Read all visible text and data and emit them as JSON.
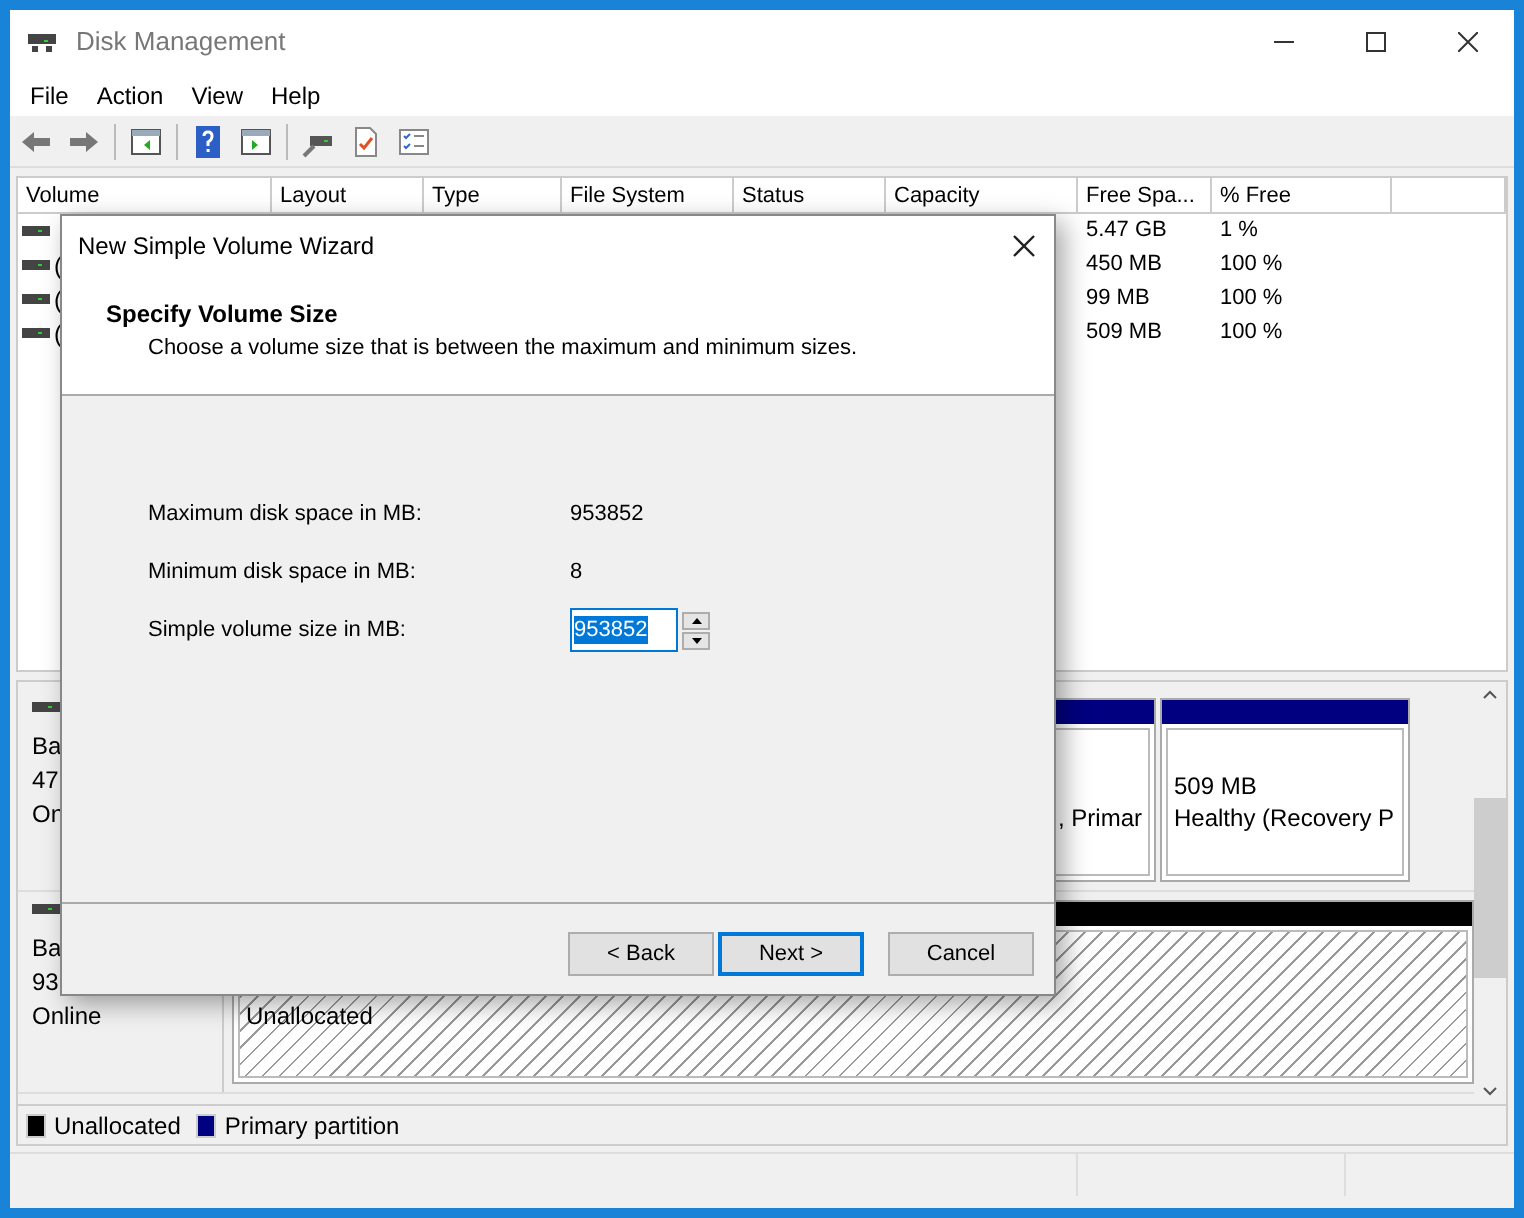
{
  "window": {
    "title": "Disk Management"
  },
  "menu": [
    {
      "label": "File"
    },
    {
      "label": "Action"
    },
    {
      "label": "View"
    },
    {
      "label": "Help"
    }
  ],
  "volume_list": {
    "columns": [
      "Volume",
      "Layout",
      "Type",
      "File System",
      "Status",
      "Capacity",
      "Free Spa...",
      "% Free"
    ],
    "rows": [
      {
        "free_space": "5.47 GB",
        "percent_free": "1 %"
      },
      {
        "volume": "(",
        "free_space": "450 MB",
        "percent_free": "100 %"
      },
      {
        "volume": "(",
        "free_space": "99 MB",
        "percent_free": "100 %"
      },
      {
        "volume": "(",
        "free_space": "509 MB",
        "percent_free": "100 %"
      }
    ]
  },
  "disks": [
    {
      "info": [
        "Ba",
        "47",
        "On"
      ],
      "partitions": [
        {
          "kind": "primary",
          "lines": [
            ", Primar"
          ]
        },
        {
          "kind": "primary",
          "lines": [
            "509 MB",
            "Healthy (Recovery P"
          ]
        }
      ]
    },
    {
      "info": [
        "Ba",
        "93",
        "Online"
      ],
      "partitions": [
        {
          "kind": "unallocated",
          "lines": [
            "Unallocated"
          ]
        }
      ]
    }
  ],
  "legend": [
    {
      "label": "Unallocated",
      "color": "#000000"
    },
    {
      "label": "Primary partition",
      "color": "#000080"
    }
  ],
  "dialog": {
    "title": "New Simple Volume Wizard",
    "heading": "Specify Volume Size",
    "subtitle": "Choose a volume size that is between the maximum and minimum sizes.",
    "fields": [
      {
        "kind": "text",
        "label": "Maximum disk space in MB:",
        "value": "953852"
      },
      {
        "kind": "text",
        "label": "Minimum disk space in MB:",
        "value": "8"
      },
      {
        "kind": "spin",
        "label": "Simple volume size in MB:",
        "value": "953852"
      }
    ],
    "buttons": [
      {
        "label": "< Back",
        "default": false
      },
      {
        "label": "Next >",
        "default": true
      },
      {
        "label": "Cancel",
        "default": false
      }
    ]
  }
}
